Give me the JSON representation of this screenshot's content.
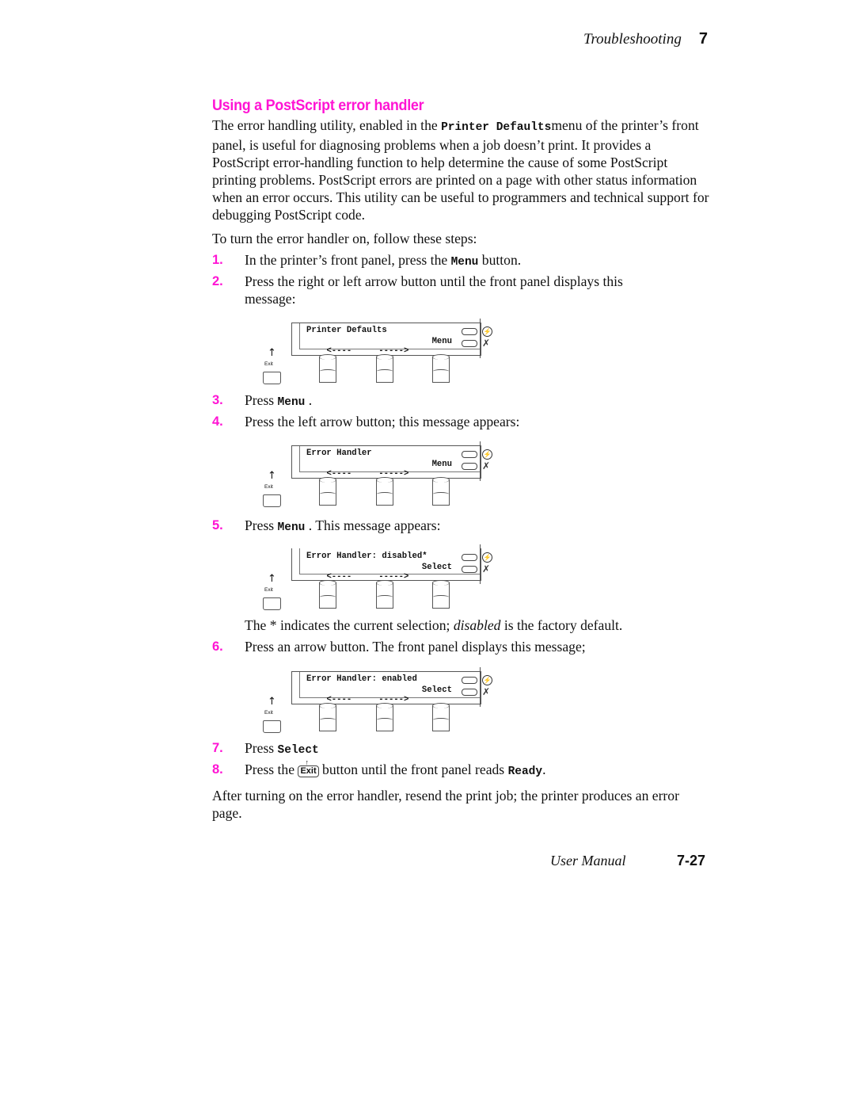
{
  "header": {
    "section": "Troubleshooting",
    "chapter": "7"
  },
  "title": "Using a PostScript error handler",
  "intro": {
    "before": "The error handling utility, enabled in the ",
    "code": "Printer Defaults",
    "after": "menu of the printer’s front panel, is useful for diagnosing problems when a job doesn’t print.  It provides a PostScript error-handling function to help determine the cause of some PostScript printing problems.  PostScript errors are printed on a page with other status information when an error occurs.  This utility can be useful to programmers and technical support for debugging PostScript code."
  },
  "lead": "To turn the error handler on, follow these steps:",
  "steps": [
    {
      "num": "1.",
      "before": "In the printer’s front panel, press the ",
      "code": "Menu",
      "after": "  button."
    },
    {
      "num": "2.",
      "text": "Press the right or left arrow button until the front panel displays this message:"
    },
    {
      "num": "3.",
      "before": "Press ",
      "code": "Menu",
      "after": " ."
    },
    {
      "num": "4.",
      "text": "Press the left arrow button; this message appears:"
    },
    {
      "num": "5.",
      "before": "Press ",
      "code": "Menu",
      "after": " .  This message appears:"
    },
    {
      "num": "6.",
      "text": "Press an arrow button.  The front panel displays this message;"
    },
    {
      "num": "7.",
      "before": "Press ",
      "code": "Select",
      "after": ""
    },
    {
      "num": "8.",
      "before": "Press the ",
      "button": "Exit",
      "middle": " button until the front panel reads ",
      "code": "Ready",
      "after": "."
    }
  ],
  "note": {
    "before": "The * indicates the current selection; ",
    "emph": "disabled",
    "after": " is the factory default."
  },
  "closing": "After turning on the error handler, resend the print job; the printer produces an error page.",
  "panels": [
    {
      "line1": "Printer Defaults",
      "left_arrow": "<----",
      "right_arrow": "----->",
      "soft_key": "Menu",
      "exit_label": "Exit",
      "exit_arrow": "↑",
      "icon_online": "⚡",
      "icon_cancel": "✗"
    },
    {
      "line1": "Error Handler",
      "left_arrow": "<----",
      "right_arrow": "----->",
      "soft_key": "Menu",
      "exit_label": "Exit",
      "exit_arrow": "↑",
      "icon_online": "⚡",
      "icon_cancel": "✗"
    },
    {
      "line1": "Error Handler: disabled*",
      "left_arrow": "<----",
      "right_arrow": "----->",
      "soft_key": "Select",
      "exit_label": "Exit",
      "exit_arrow": "↑",
      "icon_online": "⚡",
      "icon_cancel": "✗"
    },
    {
      "line1": "Error Handler: enabled",
      "left_arrow": "<----",
      "right_arrow": "----->",
      "soft_key": "Select",
      "exit_label": "Exit",
      "exit_arrow": "↑",
      "icon_online": "⚡",
      "icon_cancel": "✗"
    }
  ],
  "footer": {
    "manual": "User Manual",
    "page": "7-27"
  }
}
